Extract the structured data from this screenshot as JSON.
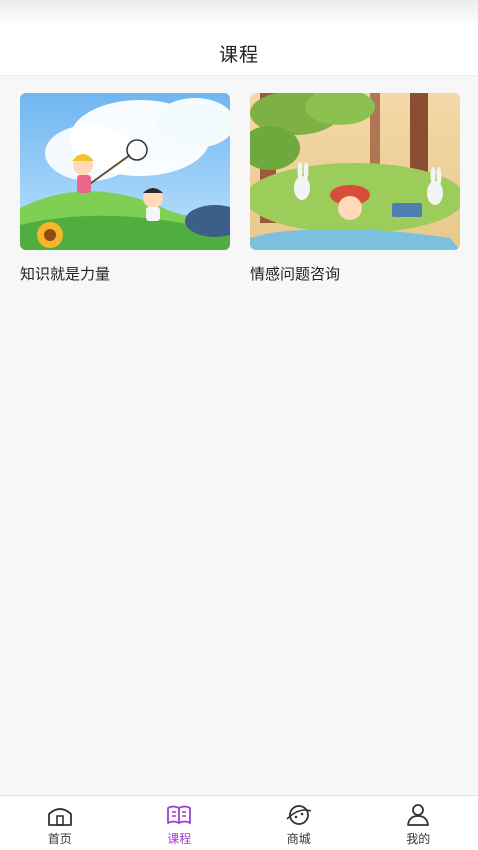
{
  "header": {
    "title": "课程"
  },
  "courses": [
    {
      "title": "知识就是力量",
      "image": "illustration-girl-with-butterfly-net"
    },
    {
      "title": "情感问题咨询",
      "image": "illustration-forest-with-rabbits"
    }
  ],
  "tabbar": {
    "active_color": "#9a3fd1",
    "items": [
      {
        "label": "首页",
        "icon": "home-icon"
      },
      {
        "label": "课程",
        "icon": "book-icon"
      },
      {
        "label": "商城",
        "icon": "planet-icon"
      },
      {
        "label": "我的",
        "icon": "user-icon"
      }
    ]
  }
}
